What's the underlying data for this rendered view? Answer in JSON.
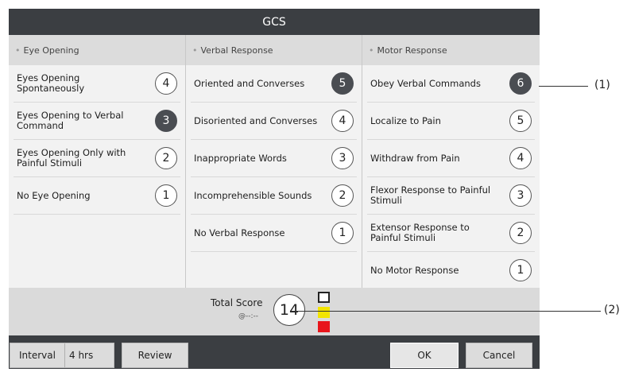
{
  "dialog": {
    "title": "GCS"
  },
  "columns": [
    {
      "header": "Eye Opening",
      "items": [
        {
          "label": "Eyes Opening Spontaneously",
          "score": "4",
          "selected": false
        },
        {
          "label": "Eyes Opening to Verbal Command",
          "score": "3",
          "selected": true
        },
        {
          "label": "Eyes Opening Only with Painful Stimuli",
          "score": "2",
          "selected": false
        },
        {
          "label": "No Eye Opening",
          "score": "1",
          "selected": false
        }
      ]
    },
    {
      "header": "Verbal Response",
      "items": [
        {
          "label": "Oriented and Converses",
          "score": "5",
          "selected": true
        },
        {
          "label": "Disoriented and Converses",
          "score": "4",
          "selected": false
        },
        {
          "label": "Inappropriate Words",
          "score": "3",
          "selected": false
        },
        {
          "label": "Incomprehensible Sounds",
          "score": "2",
          "selected": false
        },
        {
          "label": "No Verbal Response",
          "score": "1",
          "selected": false
        }
      ]
    },
    {
      "header": "Motor Response",
      "items": [
        {
          "label": "Obey Verbal Commands",
          "score": "6",
          "selected": true
        },
        {
          "label": "Localize to Pain",
          "score": "5",
          "selected": false
        },
        {
          "label": "Withdraw from Pain",
          "score": "4",
          "selected": false
        },
        {
          "label": "Flexor Response to Painful Stimuli",
          "score": "3",
          "selected": false
        },
        {
          "label": "Extensor Response to Painful Stimuli",
          "score": "2",
          "selected": false
        },
        {
          "label": "No Motor Response",
          "score": "1",
          "selected": false
        }
      ]
    }
  ],
  "total": {
    "label": "Total Score",
    "time": "@--:--",
    "value": "14"
  },
  "level_colors": {
    "low": "#ffffff",
    "mid": "#f2e400",
    "high": "#e8151b"
  },
  "footer": {
    "interval_label": "Interval",
    "interval_value": "4 hrs",
    "review_label": "Review",
    "ok_label": "OK",
    "cancel_label": "Cancel"
  },
  "callouts": [
    "(1)",
    "(2)"
  ]
}
